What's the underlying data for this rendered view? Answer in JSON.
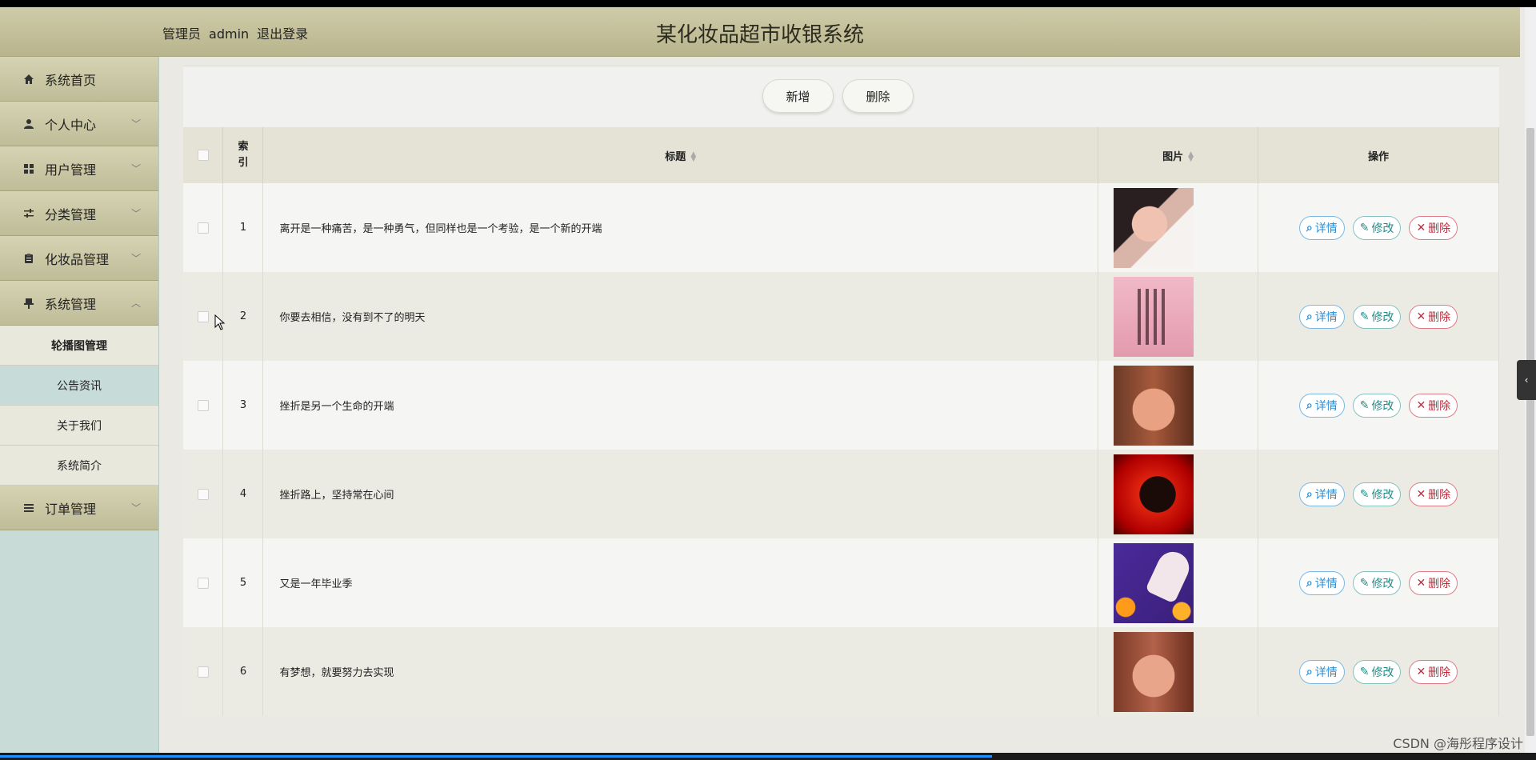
{
  "header": {
    "role": "管理员",
    "username": "admin",
    "logout_label": "退出登录",
    "app_title": "某化妆品超市收银系统"
  },
  "sidebar": {
    "items": [
      {
        "label": "系统首页",
        "icon": "home-icon"
      },
      {
        "label": "个人中心",
        "icon": "user-icon"
      },
      {
        "label": "用户管理",
        "icon": "grid-icon"
      },
      {
        "label": "分类管理",
        "icon": "sliders-icon"
      },
      {
        "label": "化妆品管理",
        "icon": "clipboard-icon"
      },
      {
        "label": "系统管理",
        "icon": "pin-icon"
      },
      {
        "label": "订单管理",
        "icon": "list-icon"
      }
    ],
    "submenu": [
      {
        "label": "轮播图管理"
      },
      {
        "label": "公告资讯"
      },
      {
        "label": "关于我们"
      },
      {
        "label": "系统简介"
      }
    ]
  },
  "toolbar": {
    "add_label": "新增",
    "delete_label": "删除"
  },
  "table": {
    "headers": {
      "index": "索引",
      "title": "标题",
      "image": "图片",
      "actions": "操作"
    },
    "rows": [
      {
        "index": "1",
        "title": "离开是一种痛苦，是一种勇气，但同样也是一个考验，是一个新的开端"
      },
      {
        "index": "2",
        "title": "你要去相信，没有到不了的明天"
      },
      {
        "index": "3",
        "title": "挫折是另一个生命的开端"
      },
      {
        "index": "4",
        "title": "挫折路上，坚持常在心间"
      },
      {
        "index": "5",
        "title": "又是一年毕业季"
      },
      {
        "index": "6",
        "title": "有梦想，就要努力去实现"
      }
    ],
    "row_actions": {
      "detail": "详情",
      "edit": "修改",
      "delete": "删除"
    }
  },
  "watermark": "CSDN @海彤程序设计",
  "colors": {
    "header_bg": "#c4c19c",
    "sidebar_bg": "#c9dbd7",
    "detail": "#2b8fd4",
    "edit": "#1e8c89",
    "delete": "#c22a3a"
  }
}
